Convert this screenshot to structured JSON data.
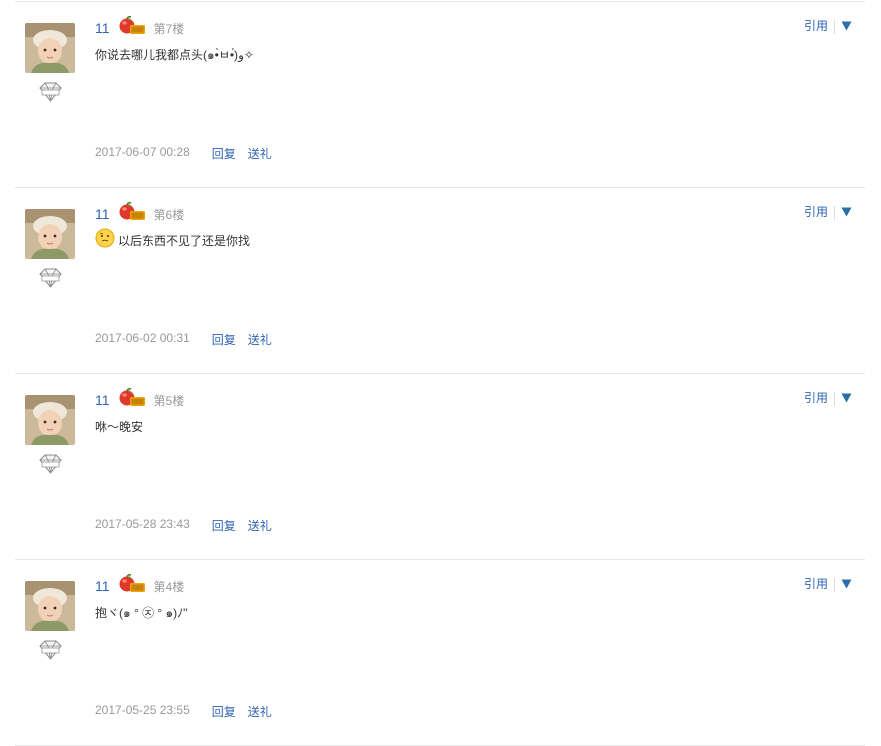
{
  "posts": [
    {
      "username": "11",
      "floor": "第7楼",
      "content": "你说去哪儿我都点头(๑•̀ㅂ•́)و✧",
      "has_emoji": false,
      "date": "2017-06-07 00:28",
      "reply": "回复",
      "gift": "送礼",
      "quote": "引用"
    },
    {
      "username": "11",
      "floor": "第6楼",
      "content": "以后东西不见了还是你找",
      "has_emoji": true,
      "date": "2017-06-02 00:31",
      "reply": "回复",
      "gift": "送礼",
      "quote": "引用"
    },
    {
      "username": "11",
      "floor": "第5楼",
      "content": "咻～晚安",
      "has_emoji": false,
      "date": "2017-05-28 23:43",
      "reply": "回复",
      "gift": "送礼",
      "quote": "引用"
    },
    {
      "username": "11",
      "floor": "第4楼",
      "content": "抱ヾ(๑ ° ㉨ ° ๑)ﾉ\"",
      "has_emoji": false,
      "date": "2017-05-25 23:55",
      "reply": "回复",
      "gift": "送礼",
      "quote": "引用"
    }
  ],
  "colors": {
    "link": "#2d64b3",
    "muted": "#999999",
    "divider": "#e6e6e6"
  },
  "icons": {
    "level": "apple-level-icon",
    "badge": "diamond-badge-icon",
    "more": "triangle-down-icon",
    "emoji": "smiley-emoji-icon"
  }
}
